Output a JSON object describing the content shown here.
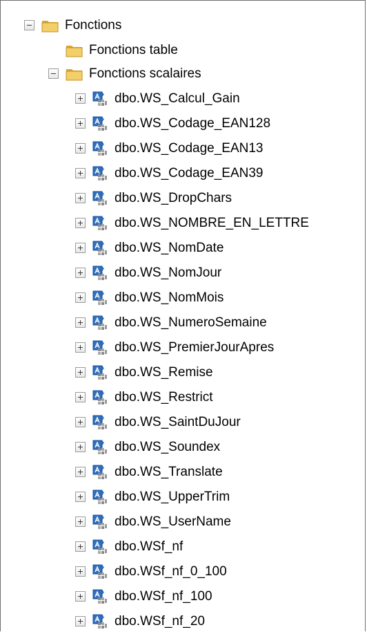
{
  "tree": {
    "root": {
      "label": "Fonctions",
      "expanded": true
    },
    "folders": [
      {
        "label": "Fonctions table",
        "expanded": null
      },
      {
        "label": "Fonctions scalaires",
        "expanded": true
      }
    ],
    "functions": [
      "dbo.WS_Calcul_Gain",
      "dbo.WS_Codage_EAN128",
      "dbo.WS_Codage_EAN13",
      "dbo.WS_Codage_EAN39",
      "dbo.WS_DropChars",
      "dbo.WS_NOMBRE_EN_LETTRE",
      "dbo.WS_NomDate",
      "dbo.WS_NomJour",
      "dbo.WS_NomMois",
      "dbo.WS_NumeroSemaine",
      "dbo.WS_PremierJourApres",
      "dbo.WS_Remise",
      "dbo.WS_Restrict",
      "dbo.WS_SaintDuJour",
      "dbo.WS_Soundex",
      "dbo.WS_Translate",
      "dbo.WS_UpperTrim",
      "dbo.WS_UserName",
      "dbo.WSf_nf",
      "dbo.WSf_nf_0_100",
      "dbo.WSf_nf_100",
      "dbo.WSf_nf_20"
    ]
  },
  "icons": {
    "toggle_expanded": "collapse-minus-icon",
    "toggle_collapsed": "expand-plus-icon",
    "folder": "folder-icon",
    "function": "scalar-function-icon"
  },
  "colors": {
    "folder_body": "#f3cf6a",
    "folder_shade": "#d9a732",
    "function_blue": "#2f6fc0",
    "function_gray": "#8a8a8a"
  }
}
